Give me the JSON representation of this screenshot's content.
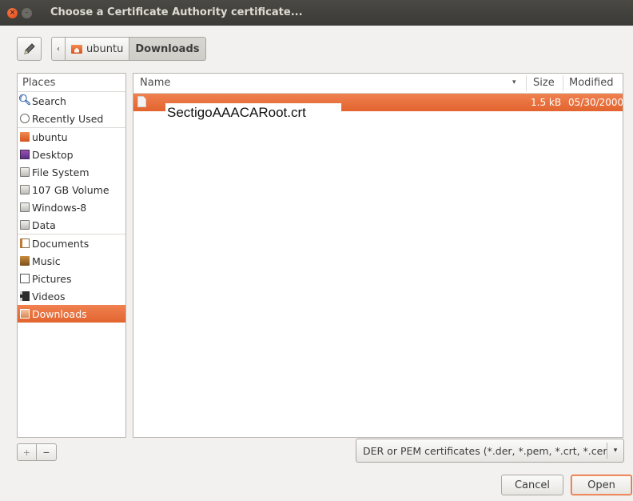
{
  "window": {
    "title": "Choose a Certificate Authority certificate...",
    "close_glyph": "×",
    "minimize_glyph": "–"
  },
  "toolbar": {
    "edit_location_icon": "pencil-icon",
    "back_glyph": "‹",
    "breadcrumbs": [
      {
        "label": "ubuntu",
        "icon": "home-folder-icon"
      },
      {
        "label": "Downloads",
        "active": true
      }
    ]
  },
  "places": {
    "header": "Places",
    "items": [
      {
        "label": "Search",
        "icon": "search-icon"
      },
      {
        "label": "Recently Used",
        "icon": "clock-icon"
      },
      {
        "label": "ubuntu",
        "icon": "home-folder-icon"
      },
      {
        "label": "Desktop",
        "icon": "desktop-icon"
      },
      {
        "label": "File System",
        "icon": "drive-icon"
      },
      {
        "label": "107 GB Volume",
        "icon": "drive-icon"
      },
      {
        "label": "Windows-8",
        "icon": "drive-icon"
      },
      {
        "label": "Data",
        "icon": "drive-icon"
      },
      {
        "label": "Documents",
        "icon": "documents-folder-icon"
      },
      {
        "label": "Music",
        "icon": "music-folder-icon"
      },
      {
        "label": "Pictures",
        "icon": "pictures-folder-icon"
      },
      {
        "label": "Videos",
        "icon": "videos-folder-icon"
      },
      {
        "label": "Downloads",
        "icon": "downloads-folder-icon",
        "selected": true
      }
    ],
    "add_glyph": "+",
    "remove_glyph": "−"
  },
  "files": {
    "columns": {
      "name": "Name",
      "size": "Size",
      "modified": "Modified"
    },
    "sort_glyph": "▾",
    "rows": [
      {
        "name": "SectigoAAACARoot.crt",
        "size": "1.5 kB",
        "modified": "05/30/2000",
        "selected": true
      }
    ]
  },
  "filter": {
    "selected": "DER or PEM certificates (*.der, *.pem, *.crt, *.cer)",
    "arrow_glyph": "▾"
  },
  "buttons": {
    "cancel": "Cancel",
    "open": "Open"
  },
  "colors": {
    "selection": "#e8703a",
    "titlebar": "#3f3e3a",
    "window_bg": "#f2f1f0"
  }
}
